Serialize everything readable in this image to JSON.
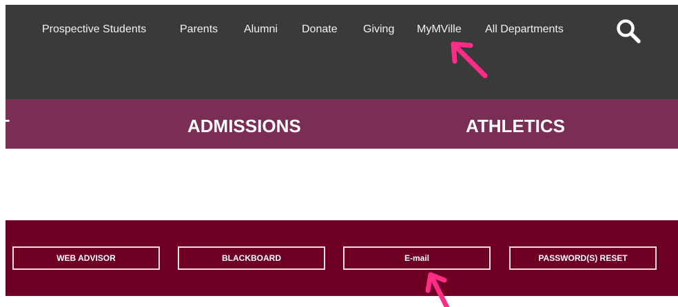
{
  "top_nav": {
    "links": [
      "Prospective Students",
      "Parents",
      "Alumni",
      "Donate",
      "Giving",
      "MyMVille",
      "All Departments"
    ],
    "search_icon": "search-icon"
  },
  "main_nav": {
    "links": [
      "T",
      "ADMISSIONS",
      "ATHLETICS"
    ]
  },
  "quick_links": {
    "buttons": [
      "WEB ADVISOR",
      "BLACKBOARD",
      "E-mail",
      "PASSWORD(S) RESET"
    ]
  },
  "annotations": {
    "arrow_color": "#ff2d87",
    "arrow_icon": "pointer-arrow-icon"
  },
  "colors": {
    "top_bar": "#3a3a3a",
    "main_nav": "#7a2d55",
    "quick_bar": "#6e0023"
  }
}
